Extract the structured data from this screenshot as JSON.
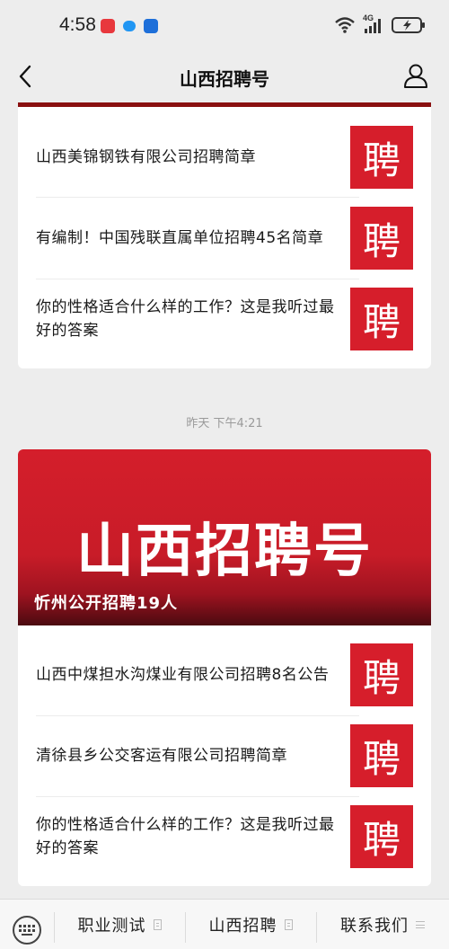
{
  "status_bar": {
    "time": "4:58",
    "network": "4G",
    "app_icons": [
      "news-app-icon",
      "chat-bubble-icon",
      "shield-app-icon"
    ],
    "colors": {
      "news_app": "#e8383d",
      "chat_app": "#2196f3",
      "shield_app": "#1e6fd9"
    }
  },
  "nav": {
    "title": "山西招聘号"
  },
  "card1": {
    "articles": [
      {
        "title": "山西美锦钢铁有限公司招聘简章",
        "thumb": "聘"
      },
      {
        "title": "有编制！中国残联直属单位招聘45名简章",
        "thumb": "聘"
      },
      {
        "title": "你的性格适合什么样的工作？这是我听过最好的答案",
        "thumb": "聘"
      }
    ]
  },
  "timestamp": "昨天 下午4:21",
  "card2": {
    "banner_text": "山西招聘号",
    "banner_caption": "忻州公开招聘19人",
    "articles": [
      {
        "title": "山西中煤担水沟煤业有限公司招聘8名公告",
        "thumb": "聘"
      },
      {
        "title": "清徐县乡公交客运有限公司招聘简章",
        "thumb": "聘"
      },
      {
        "title": "你的性格适合什么样的工作？这是我听过最好的答案",
        "thumb": "聘"
      }
    ]
  },
  "menu": {
    "items": [
      {
        "label": "职业测试"
      },
      {
        "label": "山西招聘"
      },
      {
        "label": "联系我们"
      }
    ]
  },
  "colors": {
    "accent_red": "#d61e2b",
    "dark_red": "#8a1010",
    "background": "#ededed"
  }
}
